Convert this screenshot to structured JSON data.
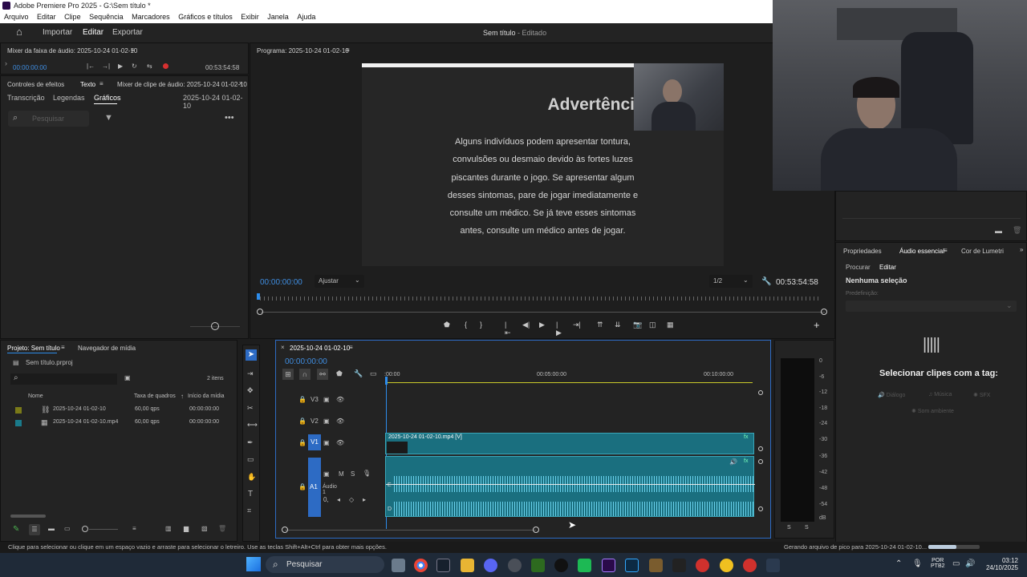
{
  "window": {
    "title": "Adobe Premiere Pro 2025 - G:\\Sem título *"
  },
  "menu": [
    "Arquivo",
    "Editar",
    "Clipe",
    "Sequência",
    "Marcadores",
    "Gráficos e títulos",
    "Exibir",
    "Janela",
    "Ajuda"
  ],
  "workspace": {
    "import": "Importar",
    "edit": "Editar",
    "export": "Exportar",
    "project_title": "Sem título",
    "project_status": "- Editado"
  },
  "audio_mixer": {
    "title": "Mixer da faixa de áudio: 2025-10-24 01-02-10",
    "timecode": "00:00:00:00",
    "duration": "00:53:54:58"
  },
  "effects_panel": {
    "tabs": [
      "Controles de efeitos",
      "Texto",
      "Mixer de clipe de áudio: 2025-10-24 01-02-10"
    ],
    "subtabs": [
      "Transcrição",
      "Legendas",
      "Gráficos"
    ],
    "sequence": "2025-10-24 01-02-10",
    "search_placeholder": "Pesquisar"
  },
  "program": {
    "title": "Programa: 2025-10-24 01-02-10",
    "warning_title": "Advertência de saúde",
    "warning_lines": [
      "Alguns indivíduos podem apresentar tontura,",
      "convulsões ou desmaio devido às fortes luzes",
      "piscantes durante o jogo. Se apresentar algum",
      "desses sintomas, pare de jogar imediatamente e",
      "consulte um médico. Se já teve esses sintomas",
      "antes, consulte um médico antes de jogar."
    ],
    "timecode": "00:00:00:00",
    "fit": "Ajustar",
    "resolution": "1/2",
    "duration": "00:53:54:58"
  },
  "project": {
    "tabs": [
      "Projeto: Sem título",
      "Navegador de mídia"
    ],
    "file": "Sem título.prproj",
    "count": "2 itens",
    "columns": [
      "Nome",
      "Taxa de quadros",
      "Início da mídia"
    ],
    "rows": [
      {
        "name": "2025-10-24 01-02-10",
        "fps": "60,00 qps",
        "start": "00:00:00:00",
        "color": "#7a7a18"
      },
      {
        "name": "2025-10-24 01-02-10.mp4",
        "fps": "60,00 qps",
        "start": "00:00:00:00",
        "color": "#1a7a8a"
      }
    ]
  },
  "timeline": {
    "title": "2025-10-24 01-02-10",
    "timecode": "00:00:00:00",
    "ruler": [
      ":00:00",
      "00:05:00:00",
      "00:10:00:00"
    ],
    "tracks": {
      "v3": "V3",
      "v2": "V2",
      "v1": "V1",
      "a1": "A1",
      "a1_name": "Áudio 1"
    },
    "video_clip": "2025-10-24 01-02-10.mp4 [V]"
  },
  "meter": {
    "labels": [
      "0",
      "-6",
      "-12",
      "-18",
      "-24",
      "-30",
      "-36",
      "-42",
      "-48",
      "-54",
      "dB"
    ],
    "solo": "S"
  },
  "right_panel": {
    "tabs": [
      "Propriedades",
      "Áudio essencial",
      "Cor de Lumetri"
    ],
    "subtabs": [
      "Procurar",
      "Editar"
    ],
    "no_selection": "Nenhuma seleção",
    "preset": "Predefinição:",
    "select_clips": "Selecionar clipes com a tag:",
    "tags": [
      "Diálogo",
      "Música",
      "SFX",
      "Som ambiente"
    ]
  },
  "status": {
    "hint": "Clique para selecionar ou clique em um espaço vazio e arraste para selecionar o letreiro. Use as teclas Shift+Alt+Ctrl para obter mais opções.",
    "progress": "Gerando arquivo de pico para 2025-10-24 01-02-10...",
    "progress_value": 0.55
  },
  "taskbar": {
    "search": "Pesquisar",
    "lang": "POR",
    "layout": "PTB2",
    "time": "03:12",
    "date": "24/10/2025"
  },
  "colors": {
    "accent": "#2d8ceb",
    "clip": "#1a6f7f",
    "taskbar": "#1f2a38"
  }
}
